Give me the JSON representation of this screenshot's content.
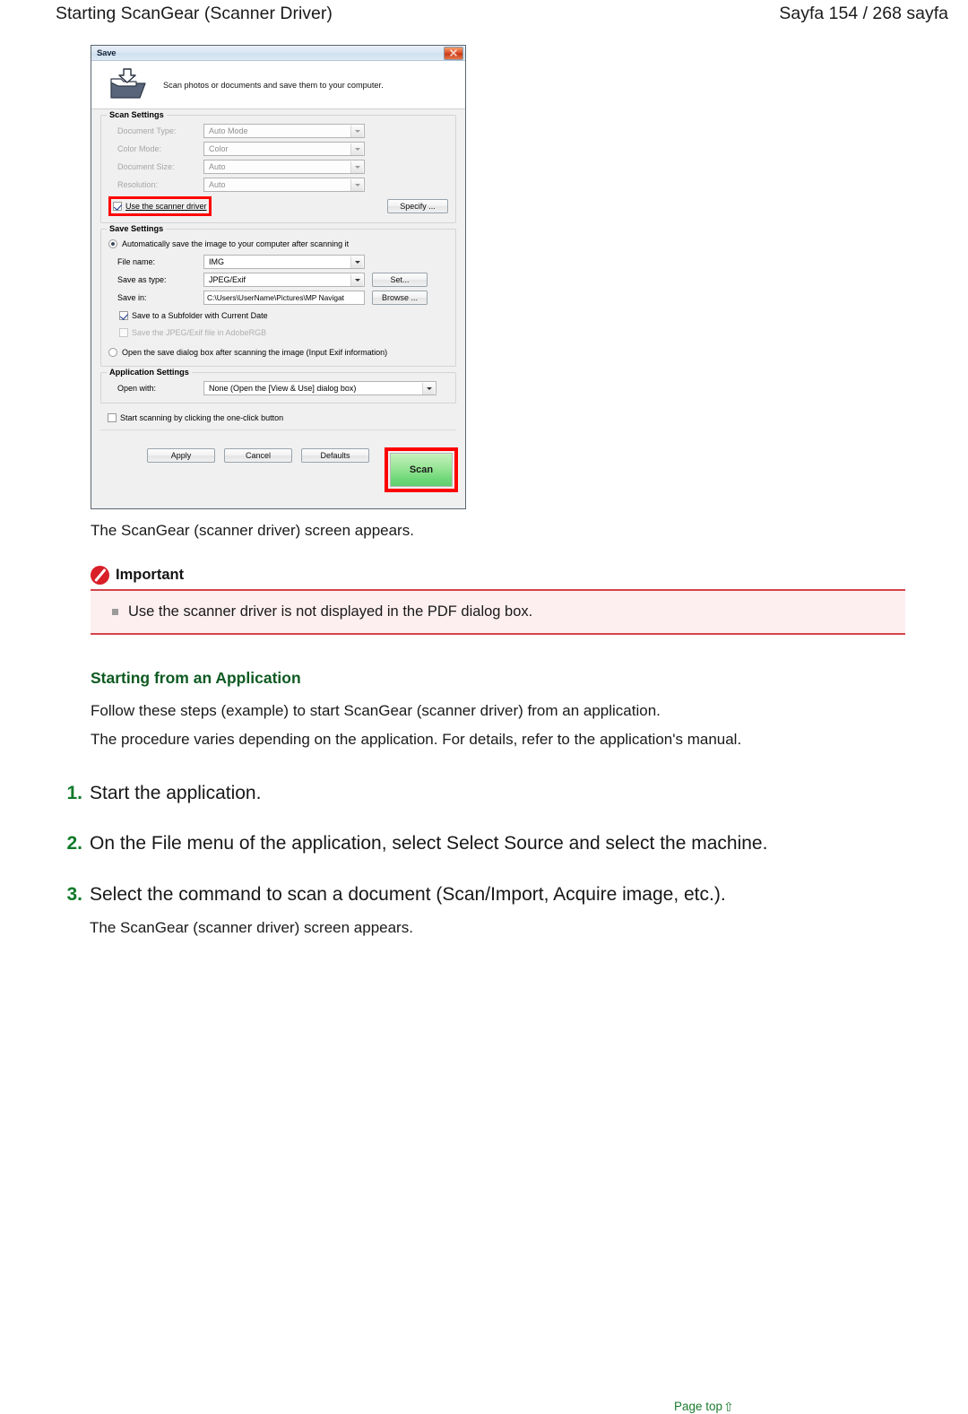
{
  "page_header": {
    "title": "Starting ScanGear (Scanner Driver)",
    "page_info": "Sayfa 154 / 268 sayfa"
  },
  "dialog": {
    "title": "Save",
    "banner_text": "Scan photos or documents and save them to your computer.",
    "close_button_label": "",
    "scan_settings": {
      "legend": "Scan Settings",
      "fields": [
        {
          "label": "Document Type:",
          "value": "Auto Mode",
          "disabled": true
        },
        {
          "label": "Color Mode:",
          "value": "Color",
          "disabled": true
        },
        {
          "label": "Document Size:",
          "value": "Auto",
          "disabled": true
        },
        {
          "label": "Resolution:",
          "value": "Auto",
          "disabled": true
        }
      ],
      "use_driver_checkbox": "Use the scanner driver",
      "use_driver_checked": true,
      "specify_button": "Specify ..."
    },
    "save_settings": {
      "legend": "Save Settings",
      "radio_auto_save": "Automatically save the image to your computer after scanning it",
      "radio_auto_save_selected": true,
      "file_name_label": "File name:",
      "file_name_value": "IMG",
      "save_as_type_label": "Save as  type:",
      "save_as_type_value": "JPEG/Exif",
      "set_button": "Set...",
      "save_in_label": "Save in:",
      "save_in_value": "C:\\Users\\UserName\\Pictures\\MP Navigat",
      "browse_button": "Browse ...",
      "subfolder_checkbox": "Save to a Subfolder with Current Date",
      "subfolder_checked": true,
      "adobergb_checkbox": "Save the JPEG/Exif file in AdobeRGB",
      "adobergb_checked": false,
      "adobergb_disabled": true,
      "radio_open_dialog": "Open the save dialog box after scanning the image (Input Exif information)",
      "radio_open_dialog_selected": false
    },
    "application_settings": {
      "legend": "Application Settings",
      "open_with_label": "Open with:",
      "open_with_value": "None (Open the [View & Use] dialog box)",
      "one_click_checkbox": "Start scanning by clicking the one-click button",
      "one_click_checked": false
    },
    "buttons": {
      "apply": "Apply",
      "cancel": "Cancel",
      "defaults": "Defaults",
      "scan": "Scan"
    },
    "highlight_color": "#ff0000",
    "scan_button_color": "#72d97a"
  },
  "article": {
    "caption_after_dialog": "The ScanGear (scanner driver) screen appears.",
    "important": {
      "title": "Important",
      "items": [
        "Use the scanner driver is not displayed in the PDF dialog box."
      ]
    },
    "section_heading": "Starting from an Application",
    "intro_paragraphs": [
      "Follow these steps (example) to start ScanGear (scanner driver) from an application.",
      "The procedure varies depending on the application. For details, refer to the application's manual."
    ],
    "steps": [
      {
        "num": "1.",
        "text": "Start the application.",
        "sub": ""
      },
      {
        "num": "2.",
        "text": "On the File menu of the application, select Select Source and select the machine.",
        "sub": ""
      },
      {
        "num": "3.",
        "text": "Select the command to scan a document (Scan/Import, Acquire image, etc.).",
        "sub": "The ScanGear (scanner driver) screen appears."
      }
    ],
    "page_top_link": "Page top",
    "page_top_arrow": "⇧"
  }
}
